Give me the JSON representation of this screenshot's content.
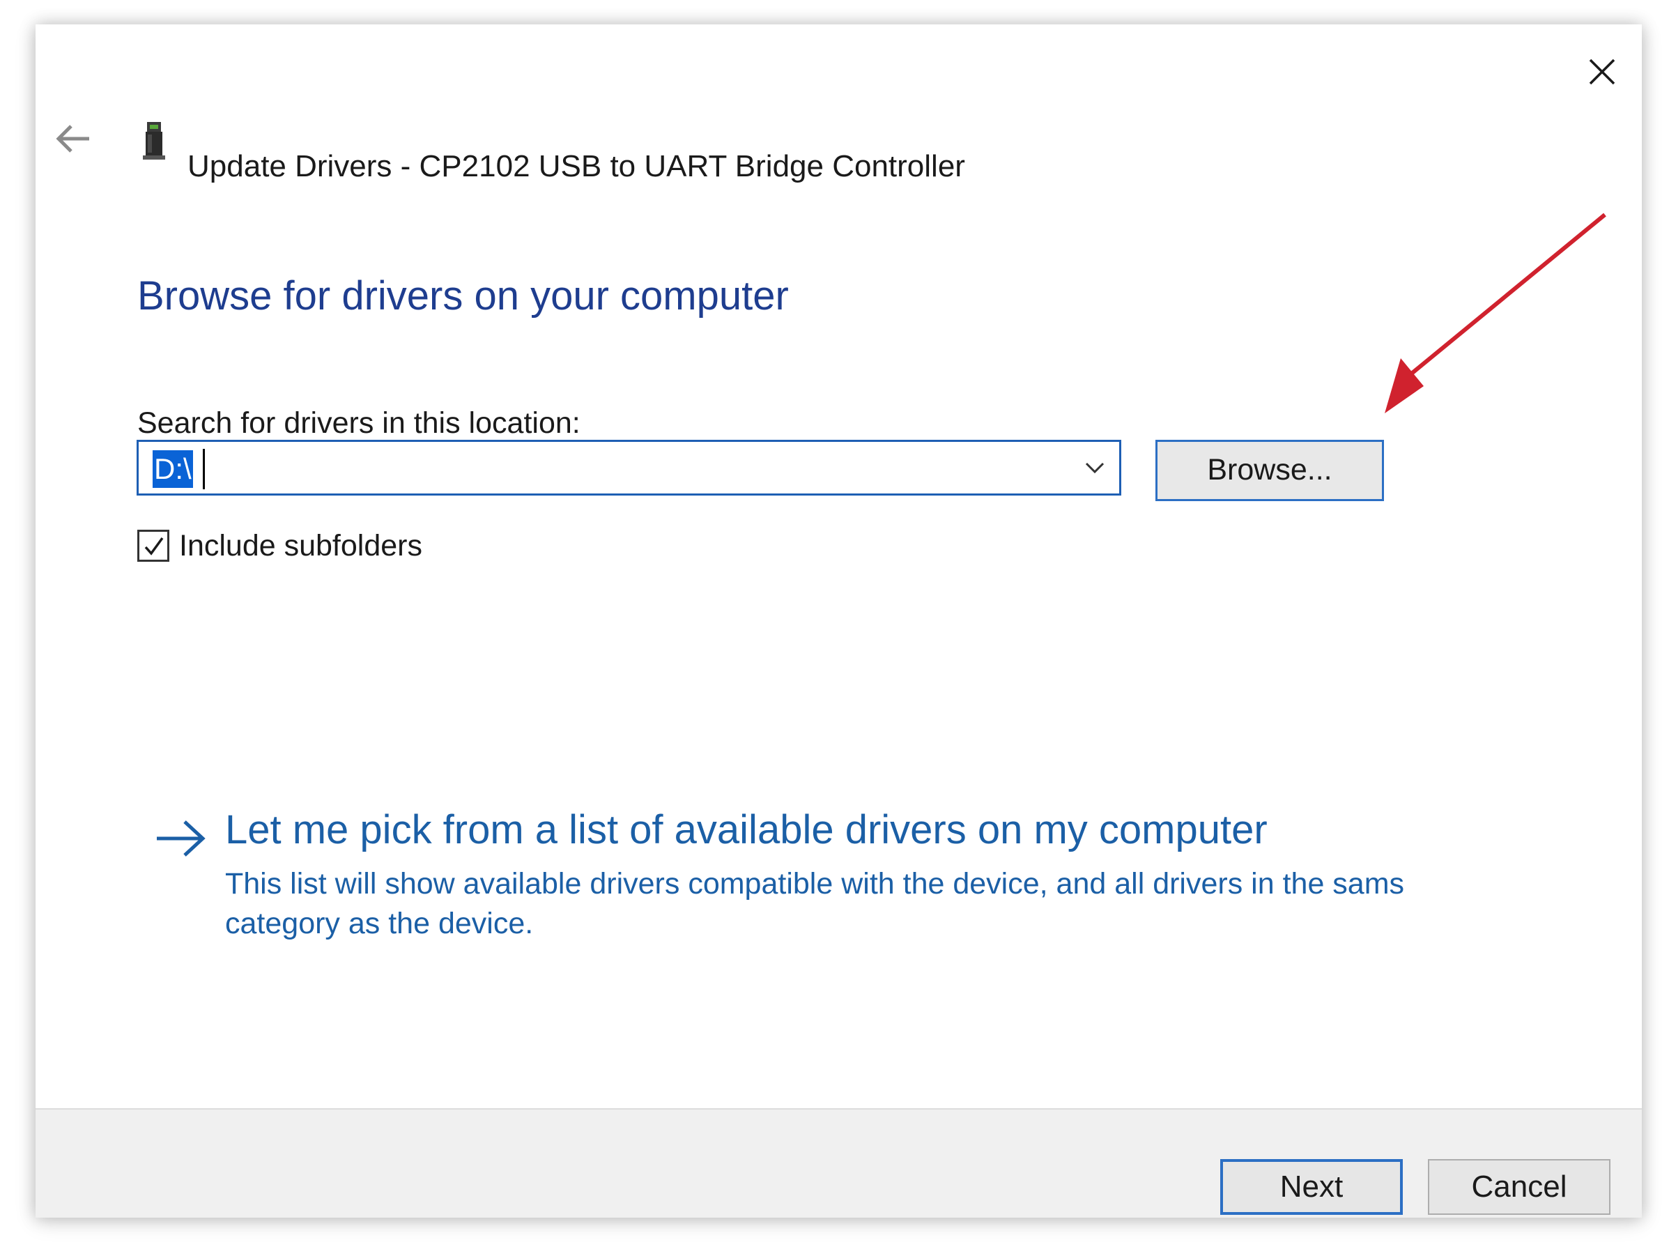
{
  "window": {
    "title": "Update Drivers - CP2102 USB to UART Bridge Controller",
    "close_icon": "close-icon",
    "back_icon": "back-arrow-icon",
    "device_icon": "usb-device-icon"
  },
  "main": {
    "heading": "Browse for drivers on your computer",
    "search_label": "Search for drivers in this location:",
    "location_value": "D:\\",
    "browse_label": "Browse...",
    "include_subfolders_label": "Include subfolders",
    "include_subfolders_checked": true
  },
  "pick_option": {
    "title": "Let me pick from a list of available drivers on my computer",
    "description": "This list will show available drivers compatible with the device, and all drivers in the sams category as the device.",
    "icon": "right-arrow-icon"
  },
  "footer": {
    "next_label": "Next",
    "cancel_label": "Cancel"
  },
  "annotation": {
    "icon": "red-pointer-arrow",
    "color": "#d0222e"
  },
  "colors": {
    "heading": "#1e3d8f",
    "link": "#1b5fa6",
    "focus_border": "#2c6fc4",
    "selection": "#0a63d6"
  }
}
